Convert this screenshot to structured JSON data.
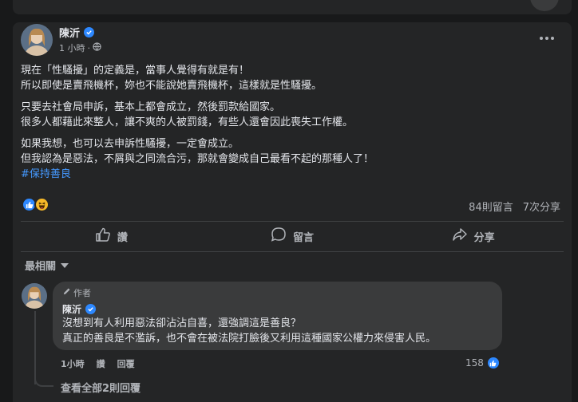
{
  "post": {
    "author": "陳沂",
    "time": "1 小時",
    "time_separator": "·",
    "lines": [
      "現在「性騷擾」的定義是，當事人覺得有就是有！",
      "所以即使是賣飛機杯，妳也不能說她賣飛機杯，這樣就是性騷擾。",
      "只要去社會局申訴，基本上都會成立，然後罰款給國家。",
      "很多人都藉此來整人，讓不爽的人被罰錢，有些人還會因此喪失工作權。",
      "如果我想，也可以去申訴性騷擾，一定會成立。",
      "但我認為是惡法，不屑與之同流合污，那就會變成自己最看不起的那種人了！"
    ],
    "hashtag": "#保持善良",
    "reaction_icons": [
      "like-icon",
      "haha-icon"
    ],
    "comment_count": "84則留言",
    "share_count": "7次分享"
  },
  "actions": {
    "like": "讚",
    "comment": "留言",
    "share": "分享"
  },
  "sort": {
    "label": "最相關"
  },
  "comment": {
    "badge": "作者",
    "author": "陳沂",
    "lines": [
      "沒想到有人利用惡法卻沾沾自喜，還強調這是善良？",
      "真正的善良是不濫訴，也不會在被法院打臉後又利用這種國家公權力來侵害人民。"
    ],
    "time": "1小時",
    "like": "讚",
    "reply": "回覆",
    "like_count": "158",
    "view_replies": "查看全部2則回覆"
  },
  "colors": {
    "background": "#18191a",
    "card": "#242526",
    "bubble": "#3a3b3c",
    "accent": "#2d88ff",
    "hashtag": "#4599ff",
    "text_primary": "#e4e6eb",
    "text_secondary": "#b0b3b8"
  }
}
